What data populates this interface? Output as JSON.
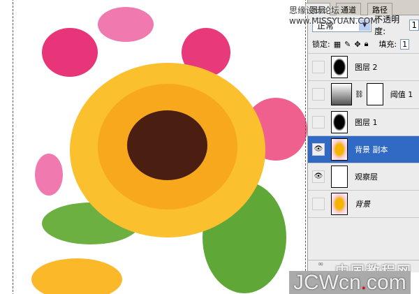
{
  "watermark_top": "思缘设计论坛 www.MISSYUAN.COM",
  "tabs": [
    "图层",
    "通道",
    "路径"
  ],
  "blend_mode": "正常",
  "opacity_label": "不透明度:",
  "opacity_value": "1",
  "lock_label": "锁定:",
  "fill_label": "填充:",
  "fill_value": "1",
  "layers": [
    {
      "name": "图层 2",
      "visible": false
    },
    {
      "name": "阈值 1",
      "visible": false
    },
    {
      "name": "图层 1",
      "visible": false
    },
    {
      "name": "背景 副本",
      "visible": true,
      "selected": true
    },
    {
      "name": "观察层",
      "visible": true
    },
    {
      "name": "背景",
      "visible": false
    }
  ],
  "watermark_cn": "中国教程网",
  "watermark_site_a": "JCWcn",
  "watermark_site_dot": ".",
  "watermark_site_b": "com"
}
